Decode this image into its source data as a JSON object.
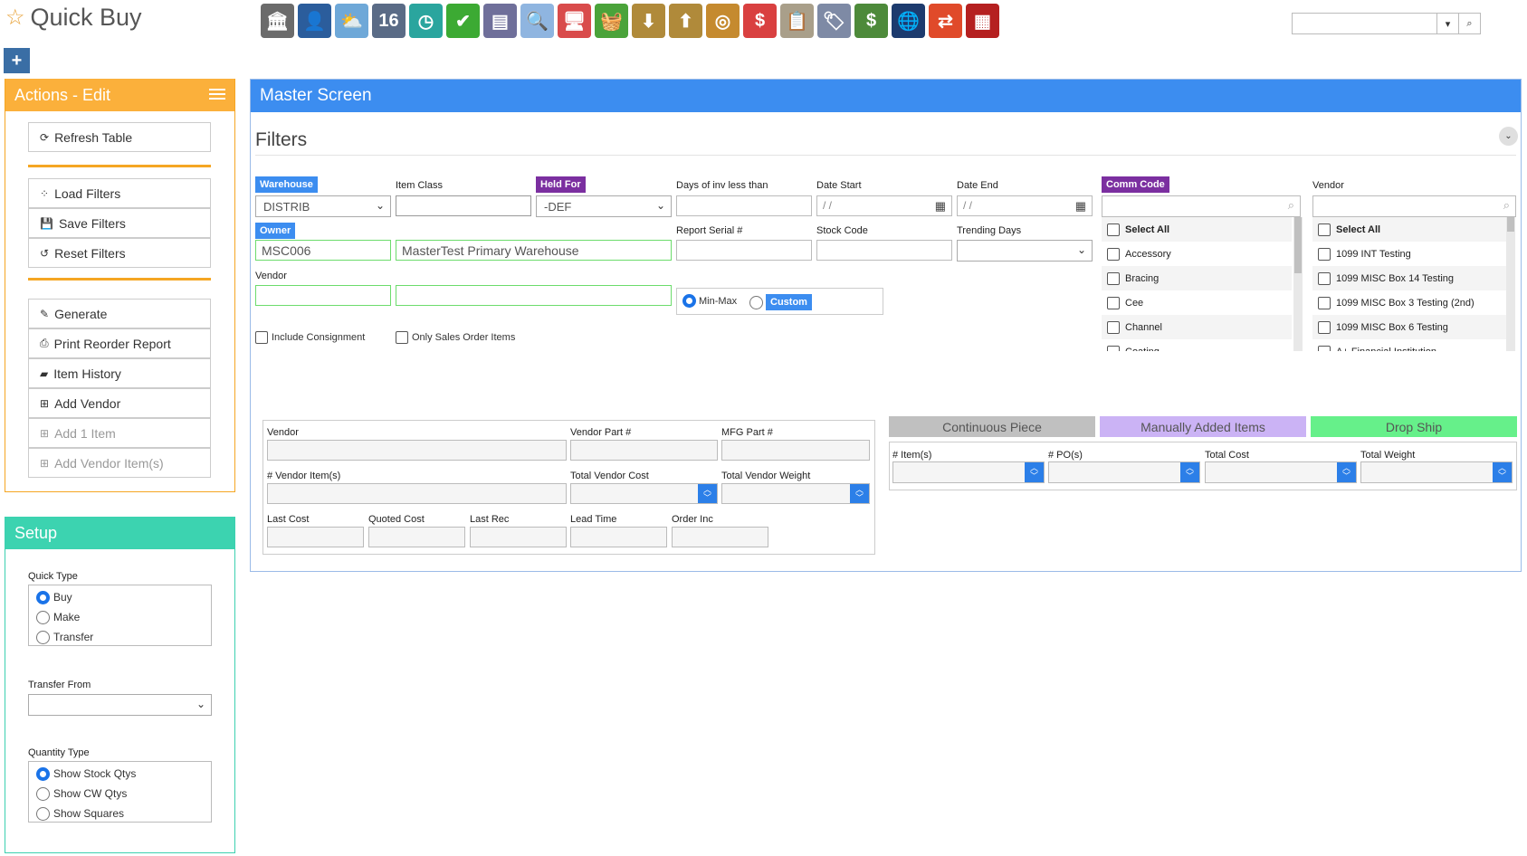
{
  "app": {
    "title": "Quick Buy"
  },
  "toolbar": {
    "icons": [
      {
        "name": "bank-icon",
        "color": "#6b6b6b",
        "glyph": "🏛"
      },
      {
        "name": "user-icon",
        "color": "#2b5d9c",
        "glyph": "👤"
      },
      {
        "name": "weather-icon",
        "color": "#6ea8d8",
        "glyph": "⛅"
      },
      {
        "name": "calendar-16-icon",
        "color": "#5a6b86",
        "glyph": "16"
      },
      {
        "name": "clock-icon",
        "color": "#2aa59e",
        "glyph": "◷"
      },
      {
        "name": "checkmark-icon",
        "color": "#3caa33",
        "glyph": "✔"
      },
      {
        "name": "keyboard-icon",
        "color": "#6f6f9a",
        "glyph": "▤"
      },
      {
        "name": "search-magnifier-icon",
        "color": "#8fb5e0",
        "glyph": "🔍"
      },
      {
        "name": "monitor-icon",
        "color": "#d94b4b",
        "glyph": "🖥"
      },
      {
        "name": "basket-icon",
        "color": "#4aa33a",
        "glyph": "🧺"
      },
      {
        "name": "inbox-download-icon",
        "color": "#b08a3a",
        "glyph": "⬇"
      },
      {
        "name": "outbox-upload-icon",
        "color": "#b08a3a",
        "glyph": "⬆"
      },
      {
        "name": "coins-icon",
        "color": "#c58a2f",
        "glyph": "◎"
      },
      {
        "name": "dollar-chat-icon",
        "color": "#d94040",
        "glyph": "$"
      },
      {
        "name": "clipboard-icon",
        "color": "#a99f8a",
        "glyph": "📋"
      },
      {
        "name": "tag-icon",
        "color": "#7e8aa5",
        "glyph": "🏷"
      },
      {
        "name": "money-icon",
        "color": "#4d8a3a",
        "glyph": "$"
      },
      {
        "name": "globe-icon",
        "color": "#1d3b6e",
        "glyph": "🌐"
      },
      {
        "name": "exchange-arrows-icon",
        "color": "#e04a2a",
        "glyph": "⇄"
      },
      {
        "name": "warehouse-building-icon",
        "color": "#b52020",
        "glyph": "▦"
      }
    ]
  },
  "header_search": {
    "value": ""
  },
  "actions_panel": {
    "title": "Actions - Edit",
    "buttons": [
      {
        "label": "Refresh Table",
        "glyph": "⟳",
        "enabled": true
      },
      {
        "label": "Load Filters",
        "glyph": "⁘",
        "enabled": true
      },
      {
        "label": "Save Filters",
        "glyph": "💾",
        "enabled": true
      },
      {
        "label": "Reset Filters",
        "glyph": "↺",
        "enabled": true
      },
      {
        "label": "Generate",
        "glyph": "✎",
        "enabled": true
      },
      {
        "label": "Print Reorder Report",
        "glyph": "⎙",
        "enabled": true
      },
      {
        "label": "Item History",
        "glyph": "▰",
        "enabled": true
      },
      {
        "label": "Add Vendor",
        "glyph": "⊞",
        "enabled": true
      },
      {
        "label": "Add 1 Item",
        "glyph": "⊞",
        "enabled": false
      },
      {
        "label": "Add Vendor Item(s)",
        "glyph": "⊞",
        "enabled": false
      }
    ]
  },
  "setup_panel": {
    "title": "Setup",
    "quick_type_label": "Quick Type",
    "quick_type_options": [
      "Buy",
      "Make",
      "Transfer"
    ],
    "quick_type_selected": "Buy",
    "transfer_from_label": "Transfer From",
    "transfer_from_value": "",
    "quantity_type_label": "Quantity Type",
    "quantity_type_options": [
      "Show Stock Qtys",
      "Show CW Qtys",
      "Show Squares"
    ],
    "quantity_type_selected": "Show Stock Qtys"
  },
  "master": {
    "title": "Master Screen",
    "filters_title": "Filters",
    "warehouse": {
      "label": "Warehouse",
      "value": "DISTRIB"
    },
    "item_class": {
      "label": "Item Class",
      "value": ""
    },
    "held_for": {
      "label": "Held For",
      "value": "-DEF"
    },
    "days_inv": {
      "label": "Days of inv less than",
      "value": ""
    },
    "date_start": {
      "label": "Date Start",
      "value": " / /"
    },
    "date_end": {
      "label": "Date End",
      "value": " / /"
    },
    "owner": {
      "label": "Owner",
      "code": "MSC006",
      "name": "MasterTest Primary Warehouse"
    },
    "report_serial": {
      "label": "Report Serial #",
      "value": ""
    },
    "stock_code": {
      "label": "Stock Code",
      "value": ""
    },
    "trending_days": {
      "label": "Trending Days",
      "value": ""
    },
    "vendor": {
      "label": "Vendor",
      "code": "",
      "name": ""
    },
    "mode_options": [
      "Min-Max",
      "Custom"
    ],
    "mode_selected": "Min-Max",
    "include_consignment": "Include Consignment",
    "only_sales_order": "Only Sales Order Items",
    "comm_code": {
      "label": "Comm Code",
      "search": "",
      "items": [
        "Select All",
        "Accessory",
        "Bracing",
        "Cee",
        "Channel",
        "Coating"
      ]
    },
    "vendor_list": {
      "label": "Vendor",
      "search": "",
      "items": [
        "Select All",
        "1099 INT Testing",
        "1099 MISC Box 14 Testing",
        "1099 MISC Box 3 Testing (2nd)",
        "1099 MISC Box 6 Testing",
        "A+ Financial Institution"
      ]
    },
    "detail": {
      "vendor": "Vendor",
      "vendor_part": "Vendor Part #",
      "mfg_part": "MFG Part #",
      "vendor_items": "# Vendor Item(s)",
      "total_vendor_cost": "Total Vendor Cost",
      "total_vendor_weight": "Total Vendor Weight",
      "last_cost": "Last Cost",
      "quoted_cost": "Quoted Cost",
      "last_rec": "Last Rec",
      "lead_time": "Lead Time",
      "order_inc": "Order Inc"
    },
    "legend": [
      {
        "label": "Continuous Piece",
        "color": "#c0c0c0"
      },
      {
        "label": "Manually Added Items",
        "color": "#cbb3f5"
      },
      {
        "label": "Drop Ship",
        "color": "#66f08a"
      }
    ],
    "totals": [
      "# Item(s)",
      "# PO(s)",
      "Total Cost",
      "Total Weight"
    ]
  },
  "colors": {
    "actions": "#fbb03b",
    "setup": "#3cd3b0",
    "master": "#3c8df0",
    "badge_blue": "#3c8df0",
    "badge_purple": "#7b2fa0"
  }
}
